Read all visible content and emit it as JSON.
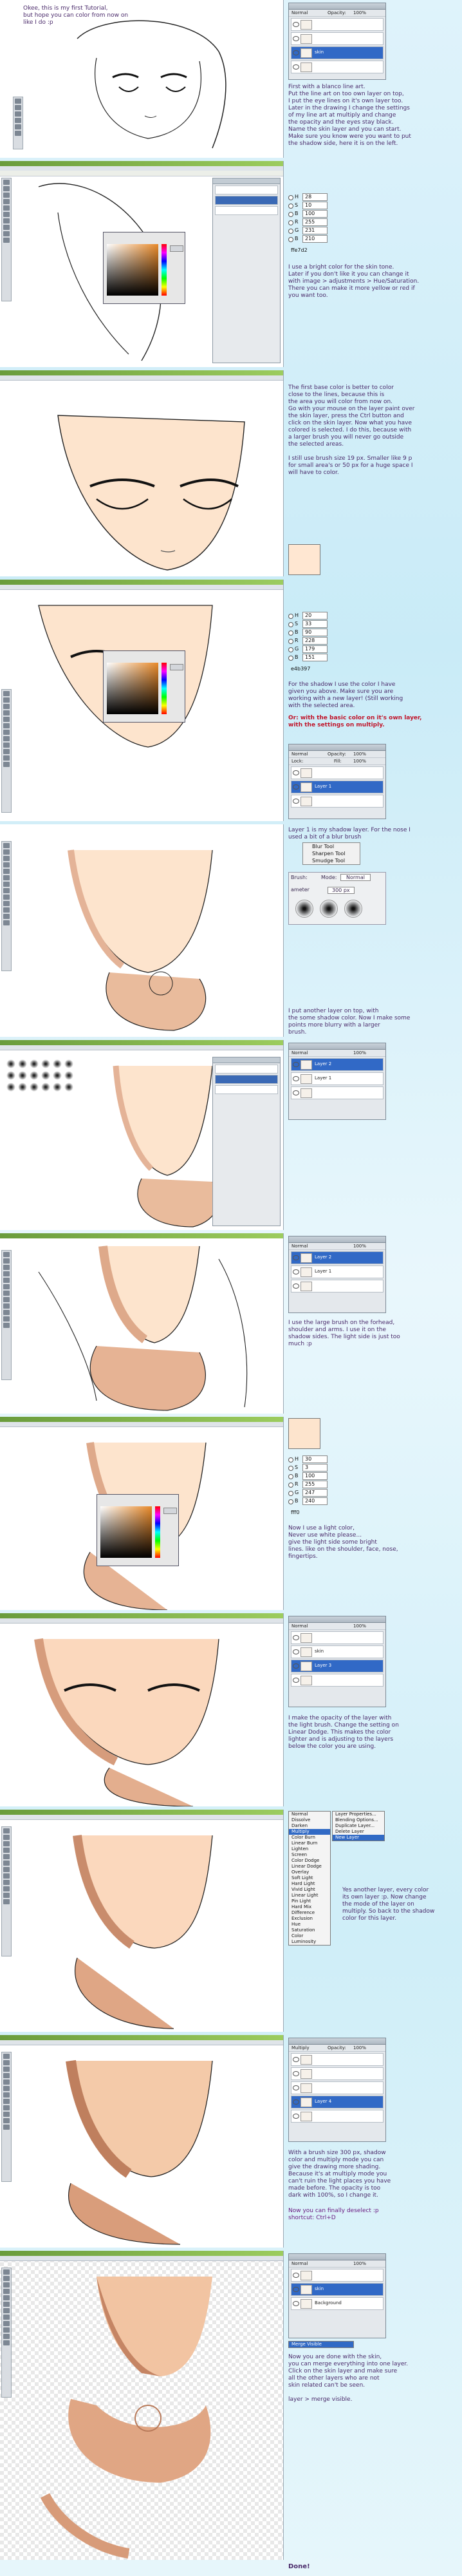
{
  "tutorial": {
    "intro": "Okee, this is my first Tutorial,\nbut hope you can color from now on\nlike I do :p",
    "steps": [
      {
        "text": "First with a blanco line art.\nPut the line art on too own layer on top,\nI put the eye lines on it's own layer too.\nLater in the drawing I change the settings\nof my line art at multiply and change\nthe opacity and the eyes stay black.\nName the skin layer and you can start.\nMake sure you know were you want to put\nthe shadow side, here it is on the left."
      },
      {
        "text": "I use a bright color for the skin tone.\nLater if you don't like it you can change it\nwith image > adjustments > Hue/Saturation.\nThere you can make it more yellow or red if\nyou want too.",
        "hex": "ffe7d2",
        "values": [
          {
            "label": "H",
            "value": "28"
          },
          {
            "label": "S",
            "value": "10"
          },
          {
            "label": "B",
            "value": "100"
          },
          {
            "label": "R",
            "value": "255"
          },
          {
            "label": "G",
            "value": "231"
          },
          {
            "label": "B",
            "value": "210"
          }
        ]
      },
      {
        "text": "The first base color is better to color\nclose to the lines, because this is\nthe area you will color from now on.\nGo with your mouse on the layer paint over\nthe skin layer, press the Ctrl button and\nclick on the skin layer. Now what you have\ncolored is selected. I do this, because with\na larger brush you will never go outside\nthe selected areas.\n\nI still use brush size 19 px. Smaller like 9 p\nfor small area's or 50 px for a huge space I\nwill have to color."
      },
      {
        "text": "For the shadow I use the color I have\ngiven you above. Make sure you are\nworking with a new layer! (Still working\nwith the selected area.",
        "red": "Or: with the basic color on it's own layer,\nwith the settings on multiply.",
        "hex": "e4b397",
        "values": [
          {
            "label": "H",
            "value": "20"
          },
          {
            "label": "S",
            "value": "33"
          },
          {
            "label": "B",
            "value": "90"
          },
          {
            "label": "R",
            "value": "228"
          },
          {
            "label": "G",
            "value": "179"
          },
          {
            "label": "B",
            "value": "151"
          }
        ]
      },
      {
        "text": "Layer 1 is my shadow layer. For the nose I\nused a bit of a blur brush",
        "tools": [
          "Blur Tool",
          "Sharpen Tool",
          "Smudge Tool"
        ],
        "brush_label": "Brush:",
        "mode_label": "Mode:",
        "mode_value": "Normal",
        "diameter_label": "ameter",
        "diameter_value": "300 px"
      },
      {
        "text": "I put another layer on top, with\nthe some shadow color. Now I make some\npoints more blurry with a larger\nbrush."
      },
      {
        "text": "I use the large brush on the forhead,\nshoulder and arms. I use it on the\nshadow sides. The light side is just too\nmuch :p"
      },
      {
        "text": "Now I use a light color,\nNever use white please...\ngive the light side some bright\nlines. like on the shoulder, face, nose,\nfingertips.",
        "hex": "fff0",
        "values": [
          {
            "label": "H",
            "value": "30"
          },
          {
            "label": "S",
            "value": "3"
          },
          {
            "label": "B",
            "value": "100"
          },
          {
            "label": "R",
            "value": "255"
          },
          {
            "label": "G",
            "value": "247"
          },
          {
            "label": "B",
            "value": "240"
          }
        ]
      },
      {
        "text": "I make the opacity of the layer with\nthe light brush. Change the setting on\nLinear Dodge. This makes the color\nlighter and is adjusting to the layers\nbelow the color you are using."
      },
      {
        "text": "Yes another layer, every color\nits own layer :p. Now change\nthe mode of the layer on\nmultiply. So back to the shadow\ncolor for this layer.",
        "blend_modes": [
          "Normal",
          "Dissolve",
          "Darken",
          "Multiply",
          "Color Burn",
          "Linear Burn",
          "Lighten",
          "Screen",
          "Color Dodge",
          "Linear Dodge",
          "Overlay",
          "Soft Light",
          "Hard Light",
          "Vivid Light",
          "Linear Light",
          "Pin Light",
          "Hard Mix",
          "Difference",
          "Exclusion",
          "Hue",
          "Saturation",
          "Color",
          "Luminosity"
        ],
        "layer_menu": [
          "Layer Properties...",
          "Blending Options...",
          "Duplicate Layer...",
          "Delete Layer",
          "New Layer"
        ]
      },
      {
        "text": "With a brush size 300 px, shadow\ncolor and multiply mode you can\ngive the drawing more shading.\nBecause it's at multiply mode you\ncan't ruin the light places you have\nmade before. The opacity is too\ndark with 100%, so I change it.",
        "extra": "Now you can finally deselect :p\nshortcut: Ctrl+D"
      },
      {
        "text": "Now you are done with the skin,\nyou can merge everything into one layer.\nClick on the skin layer and make sure\nall the other layers who are not\nskin related can't be seen.\n\nlayer > merge visible.",
        "menu_item": "Merge Visible"
      }
    ],
    "done": "Done!"
  },
  "layers_panel": {
    "title": "Layers",
    "blend": "Normal",
    "opacity_label": "Opacity:",
    "opacity": "100%",
    "lock_label": "Lock:",
    "fill_label": "Fill:",
    "fill": "100%",
    "layer_names": [
      "skin",
      "Layer 1",
      "Layer 2",
      "Layer 3",
      "Layer 4",
      "Background"
    ]
  }
}
